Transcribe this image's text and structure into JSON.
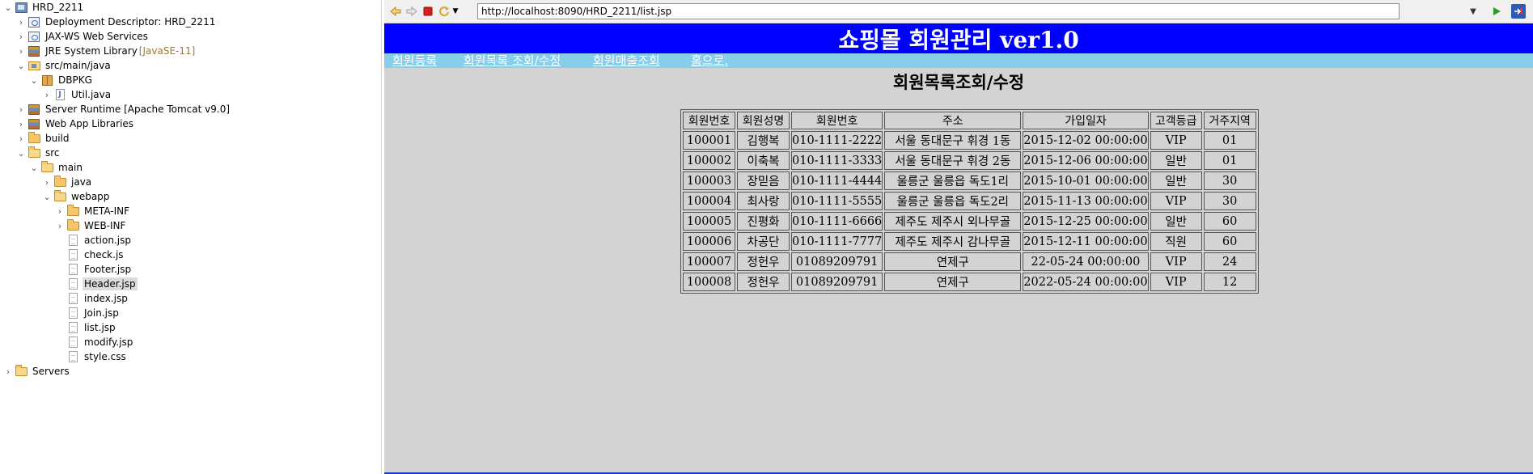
{
  "explorer": {
    "items": [
      {
        "label": "HRD_2211",
        "suffix": "",
        "icon": "project-icon",
        "twisty": "open",
        "level": 0
      },
      {
        "label": "Deployment Descriptor: HRD_2211",
        "suffix": "",
        "icon": "deployment-descriptor-icon",
        "twisty": "closed",
        "level": 1
      },
      {
        "label": "JAX-WS Web Services",
        "suffix": "",
        "icon": "web-services-icon",
        "twisty": "closed",
        "level": 1
      },
      {
        "label": "JRE System Library",
        "suffix": "[JavaSE-11]",
        "icon": "library-icon",
        "twisty": "closed",
        "level": 1
      },
      {
        "label": "src/main/java",
        "suffix": "",
        "icon": "source-folder-icon",
        "twisty": "open",
        "level": 1
      },
      {
        "label": "DBPKG",
        "suffix": "",
        "icon": "package-icon",
        "twisty": "open",
        "level": 2
      },
      {
        "label": "Util.java",
        "suffix": "",
        "icon": "java-file-icon",
        "twisty": "closed",
        "level": 3
      },
      {
        "label": "Server Runtime [Apache Tomcat v9.0]",
        "suffix": "",
        "icon": "library-icon",
        "twisty": "closed",
        "level": 1
      },
      {
        "label": "Web App Libraries",
        "suffix": "",
        "icon": "library-icon",
        "twisty": "closed",
        "level": 1
      },
      {
        "label": "build",
        "suffix": "",
        "icon": "folder-icon",
        "twisty": "closed",
        "level": 1
      },
      {
        "label": "src",
        "suffix": "",
        "icon": "folder-open-icon",
        "twisty": "open",
        "level": 1
      },
      {
        "label": "main",
        "suffix": "",
        "icon": "folder-open-icon",
        "twisty": "open",
        "level": 2
      },
      {
        "label": "java",
        "suffix": "",
        "icon": "folder-icon",
        "twisty": "closed",
        "level": 3
      },
      {
        "label": "webapp",
        "suffix": "",
        "icon": "folder-open-icon",
        "twisty": "open",
        "level": 3
      },
      {
        "label": "META-INF",
        "suffix": "",
        "icon": "folder-icon",
        "twisty": "closed",
        "level": 4
      },
      {
        "label": "WEB-INF",
        "suffix": "",
        "icon": "folder-icon",
        "twisty": "closed",
        "level": 4
      },
      {
        "label": "action.jsp",
        "suffix": "",
        "icon": "file-icon",
        "twisty": "none",
        "level": 4
      },
      {
        "label": "check.js",
        "suffix": "",
        "icon": "file-icon",
        "twisty": "none",
        "level": 4
      },
      {
        "label": "Footer.jsp",
        "suffix": "",
        "icon": "file-icon",
        "twisty": "none",
        "level": 4
      },
      {
        "label": "Header.jsp",
        "suffix": "",
        "icon": "file-icon",
        "twisty": "none",
        "level": 4,
        "selected": true
      },
      {
        "label": "index.jsp",
        "suffix": "",
        "icon": "file-icon",
        "twisty": "none",
        "level": 4
      },
      {
        "label": "Join.jsp",
        "suffix": "",
        "icon": "file-icon",
        "twisty": "none",
        "level": 4
      },
      {
        "label": "list.jsp",
        "suffix": "",
        "icon": "file-icon",
        "twisty": "none",
        "level": 4
      },
      {
        "label": "modify.jsp",
        "suffix": "",
        "icon": "file-icon",
        "twisty": "none",
        "level": 4
      },
      {
        "label": "style.css",
        "suffix": "",
        "icon": "file-icon",
        "twisty": "none",
        "level": 4
      },
      {
        "label": "Servers",
        "suffix": "",
        "icon": "folder-open-icon",
        "twisty": "closed",
        "level": 0
      }
    ]
  },
  "browser": {
    "toolbar": {
      "back_icon": "back-icon",
      "forward_icon": "forward-icon",
      "stop_icon": "stop-icon",
      "refresh_icon": "refresh-icon",
      "go_icon": "go-icon",
      "open_external_icon": "open-external-icon",
      "url": "http://localhost:8090/HRD_2211/list.jsp"
    },
    "page": {
      "banner": "쇼핑몰 회원관리 ver1.0",
      "nav": [
        "회원등록",
        "회원목록 조회/수정",
        "회원매출조회",
        "홈으로."
      ],
      "title": "회원목록조회/수정",
      "table": {
        "headers": [
          "회원번호",
          "회원성명",
          "회원번호",
          "주소",
          "가입일자",
          "고객등급",
          "거주지역"
        ],
        "rows": [
          [
            "100001",
            "김행복",
            "010-1111-2222",
            "서울 동대문구 휘경 1동",
            "2015-12-02 00:00:00",
            "VIP",
            "01"
          ],
          [
            "100002",
            "이축복",
            "010-1111-3333",
            "서울 동대문구 휘경 2동",
            "2015-12-06 00:00:00",
            "일반",
            "01"
          ],
          [
            "100003",
            "장믿음",
            "010-1111-4444",
            "울릉군 울릉읍 독도1리",
            "2015-10-01 00:00:00",
            "일반",
            "30"
          ],
          [
            "100004",
            "최사랑",
            "010-1111-5555",
            "울릉군 울릉읍 독도2리",
            "2015-11-13 00:00:00",
            "VIP",
            "30"
          ],
          [
            "100005",
            "진평화",
            "010-1111-6666",
            "제주도 제주시 외나무골",
            "2015-12-25 00:00:00",
            "일반",
            "60"
          ],
          [
            "100006",
            "차공단",
            "010-1111-7777",
            "제주도 제주시 감나무골",
            "2015-12-11 00:00:00",
            "직원",
            "60"
          ],
          [
            "100007",
            "정헌우",
            "01089209791",
            "연제구",
            "22-05-24 00:00:00",
            "VIP",
            "24"
          ],
          [
            "100008",
            "정헌우",
            "01089209791",
            "연제구",
            "2022-05-24 00:00:00",
            "VIP",
            "12"
          ]
        ]
      }
    }
  },
  "colors": {
    "banner_bg": "#0000ff",
    "nav_bg": "#87ceeb",
    "page_bg": "#d3d3d3"
  }
}
